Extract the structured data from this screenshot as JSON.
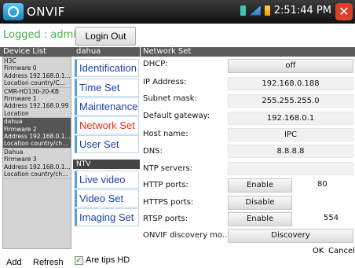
{
  "titlebar": {
    "app_title": "ONVIF",
    "time": "2:51:44 PM",
    "icons": [
      "sd-card-icon",
      "network-icon",
      "battery-icon",
      "close-icon"
    ]
  },
  "login": {
    "status": "Logged : admin",
    "logout_label": "Login Out"
  },
  "device_list": {
    "header": "Device List",
    "items": [
      {
        "lines": [
          "H3C",
          "Firmware 0",
          "Address 192.168.0.1...",
          "Location country/C..."
        ],
        "selected": false
      },
      {
        "lines": [
          "CMR-HD130-20-KB",
          "Firmware 1",
          "Address 192.168.0.99",
          "Location"
        ],
        "selected": false
      },
      {
        "lines": [
          "dahua",
          "Firmware 2",
          "Address 192.168.0.1...",
          "Location country/ch..."
        ],
        "selected": true
      },
      {
        "lines": [
          "Dahua",
          "Firmware 3",
          "Address 192.168.0.1...",
          "Location country/ch..."
        ],
        "selected": false
      }
    ],
    "add_label": "Add",
    "refresh_label": "Refresh"
  },
  "menu": {
    "header": "dahua",
    "items": [
      "Identification",
      "Time Set",
      "Maintenance",
      "Network Set",
      "User Set"
    ],
    "active_item": "Network Set",
    "ntv_header": "NTV",
    "ntv_items": [
      "Live video",
      "Video Set",
      "Imaging Set"
    ],
    "tips_label": "Are tips HD"
  },
  "network": {
    "header": "Network Set",
    "dhcp_label": "DHCP:",
    "dhcp_value": "off",
    "ip_label": "IP Address:",
    "ip_value": "192.168.0.188",
    "mask_label": "Subnet mask:",
    "mask_value": "255.255.255.0",
    "gateway_label": "Default gateway:",
    "gateway_value": "192.168.0.1",
    "host_label": "Host name:",
    "host_value": "IPC",
    "dns_label": "DNS:",
    "dns_value": "8.8.8.8",
    "ntp_label": "NTP servers:",
    "ntp_value": "",
    "http_label": "HTTP ports:",
    "http_state": "Enable",
    "http_port": "80",
    "https_label": "HTTPS ports:",
    "https_state": "Disable",
    "rtsp_label": "RTSP ports:",
    "rtsp_state": "Enable",
    "rtsp_port": "554",
    "onvif_label": "ONVIF discovery mo...",
    "onvif_value": "Discovery",
    "ok_label": "OK",
    "cancel_label": "Cancel"
  }
}
